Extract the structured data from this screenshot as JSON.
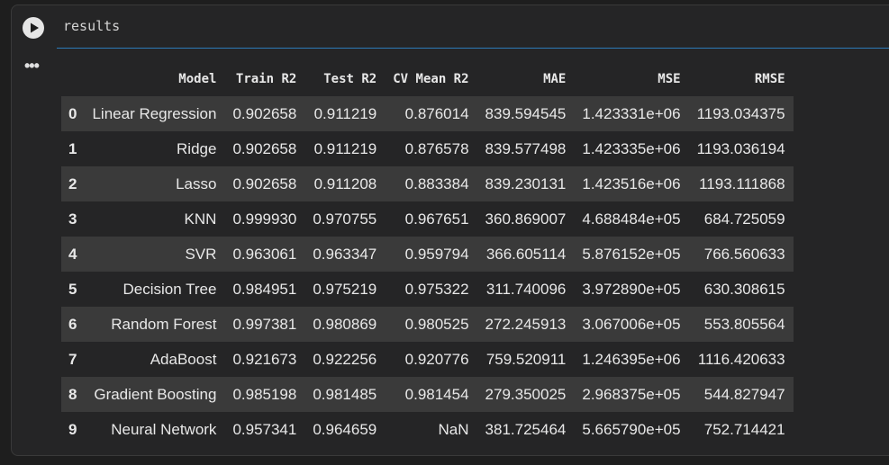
{
  "cell": {
    "code": "results",
    "run_icon": "play-icon",
    "output_menu_icon": "ellipsis-icon",
    "output_menu_glyph": "•••"
  },
  "table": {
    "columns": [
      "",
      "Model",
      "Train R2",
      "Test R2",
      "CV Mean R2",
      "MAE",
      "MSE",
      "RMSE"
    ],
    "rows": [
      [
        "0",
        "Linear Regression",
        "0.902658",
        "0.911219",
        "0.876014",
        "839.594545",
        "1.423331e+06",
        "1193.034375"
      ],
      [
        "1",
        "Ridge",
        "0.902658",
        "0.911219",
        "0.876578",
        "839.577498",
        "1.423335e+06",
        "1193.036194"
      ],
      [
        "2",
        "Lasso",
        "0.902658",
        "0.911208",
        "0.883384",
        "839.230131",
        "1.423516e+06",
        "1193.111868"
      ],
      [
        "3",
        "KNN",
        "0.999930",
        "0.970755",
        "0.967651",
        "360.869007",
        "4.688484e+05",
        "684.725059"
      ],
      [
        "4",
        "SVR",
        "0.963061",
        "0.963347",
        "0.959794",
        "366.605114",
        "5.876152e+05",
        "766.560633"
      ],
      [
        "5",
        "Decision Tree",
        "0.984951",
        "0.975219",
        "0.975322",
        "311.740096",
        "3.972890e+05",
        "630.308615"
      ],
      [
        "6",
        "Random Forest",
        "0.997381",
        "0.980869",
        "0.980525",
        "272.245913",
        "3.067006e+05",
        "553.805564"
      ],
      [
        "7",
        "AdaBoost",
        "0.921673",
        "0.922256",
        "0.920776",
        "759.520911",
        "1.246395e+06",
        "1116.420633"
      ],
      [
        "8",
        "Gradient Boosting",
        "0.985198",
        "0.981485",
        "0.981454",
        "279.350025",
        "2.968375e+05",
        "544.827947"
      ],
      [
        "9",
        "Neural Network",
        "0.957341",
        "0.964659",
        "NaN",
        "381.725464",
        "5.665790e+05",
        "752.714421"
      ]
    ]
  }
}
